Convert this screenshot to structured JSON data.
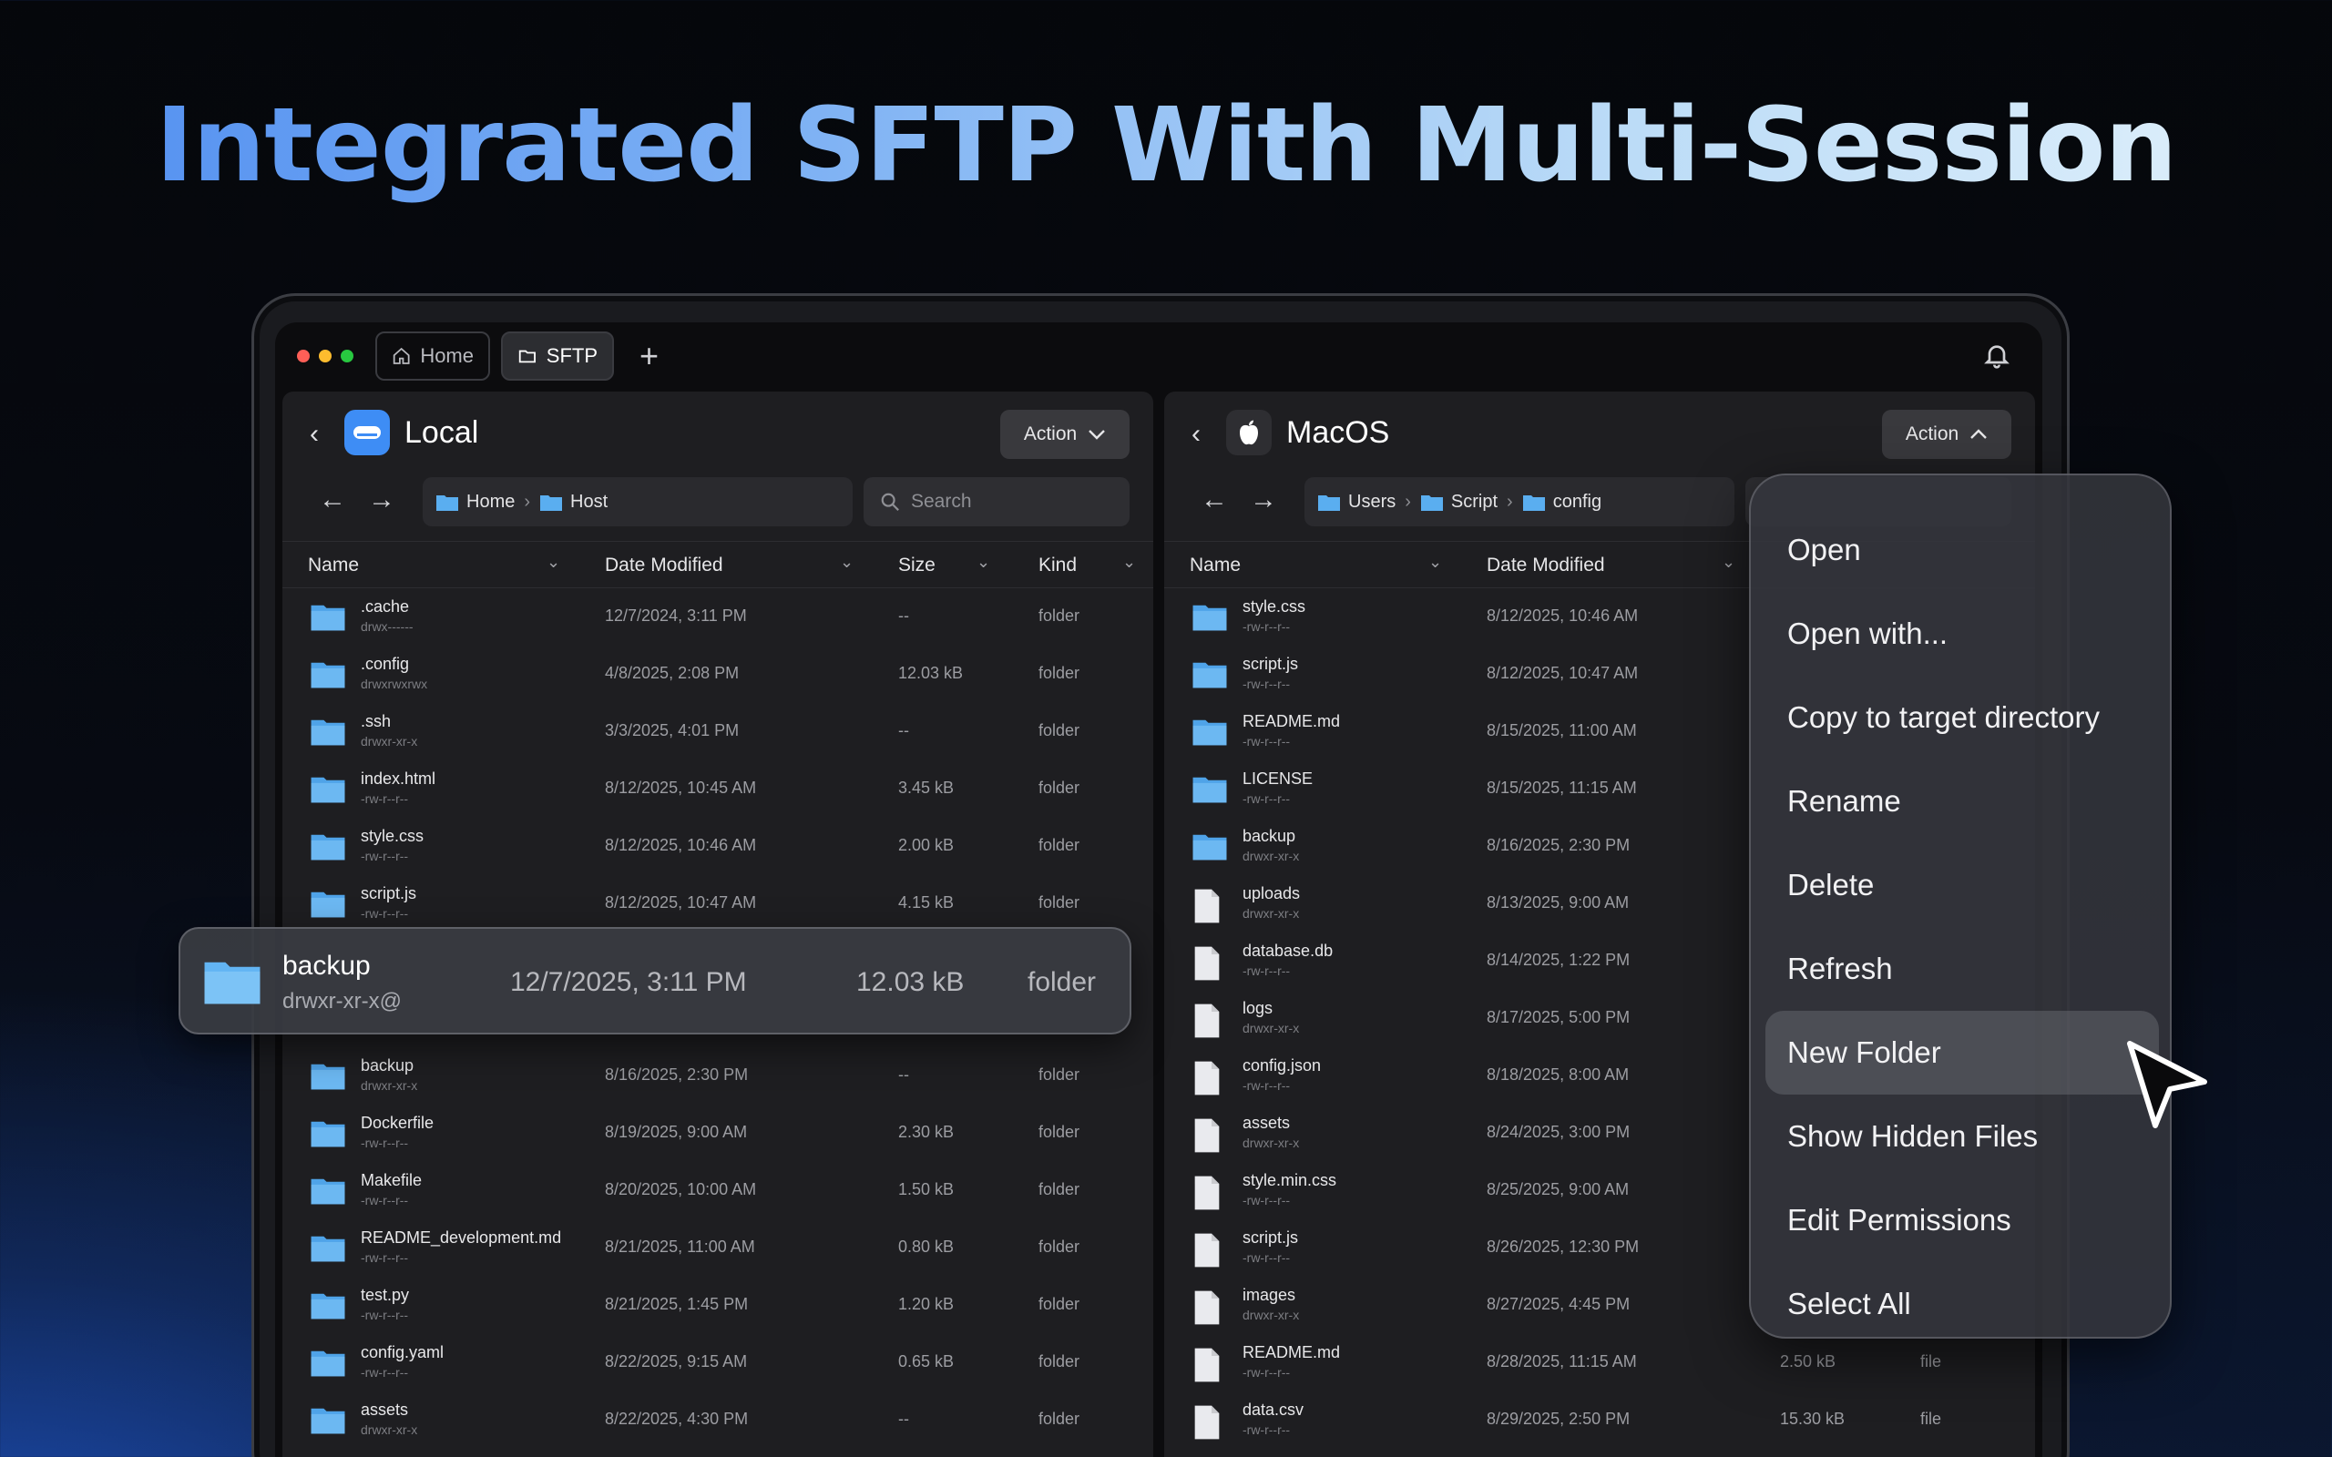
{
  "headline": "Integrated SFTP With Multi-Session",
  "titlebar": {
    "tabs": [
      {
        "label": "Home",
        "icon": "home-icon"
      },
      {
        "label": "SFTP",
        "icon": "folder-icon"
      }
    ],
    "new_tab_label": "+",
    "colors": {
      "close": "#ff5f57",
      "minimize": "#febc2e",
      "zoom": "#28c840"
    }
  },
  "left_pane": {
    "title": "Local",
    "action_label": "Action",
    "breadcrumb": [
      "Home",
      "Host"
    ],
    "search_placeholder": "Search",
    "columns": [
      "Name",
      "Date Modified",
      "Size",
      "Kind"
    ],
    "rows": [
      {
        "name": ".cache",
        "perm": "drwx------",
        "date": "12/7/2024, 3:11 PM",
        "size": "--",
        "kind": "folder"
      },
      {
        "name": ".config",
        "perm": "drwxrwxrwx",
        "date": "4/8/2025, 2:08 PM",
        "size": "12.03 kB",
        "kind": "folder"
      },
      {
        "name": ".ssh",
        "perm": "drwxr-xr-x",
        "date": "3/3/2025, 4:01 PM",
        "size": "--",
        "kind": "folder"
      },
      {
        "name": "index.html",
        "perm": "-rw-r--r--",
        "date": "8/12/2025, 10:45 AM",
        "size": "3.45 kB",
        "kind": "folder"
      },
      {
        "name": "style.css",
        "perm": "-rw-r--r--",
        "date": "8/12/2025, 10:46 AM",
        "size": "2.00 kB",
        "kind": "folder"
      },
      {
        "name": "script.js",
        "perm": "-rw-r--r--",
        "date": "8/12/2025, 10:47 AM",
        "size": "4.15 kB",
        "kind": "folder"
      },
      {
        "name": "",
        "perm": "",
        "date": "",
        "size": "",
        "kind": ""
      },
      {
        "name": "backup",
        "perm": "drwxr-xr-x",
        "date": "8/16/2025, 2:30 PM",
        "size": "--",
        "kind": "folder"
      },
      {
        "name": "Dockerfile",
        "perm": "-rw-r--r--",
        "date": "8/19/2025, 9:00 AM",
        "size": "2.30 kB",
        "kind": "folder"
      },
      {
        "name": "Makefile",
        "perm": "-rw-r--r--",
        "date": "8/20/2025, 10:00 AM",
        "size": "1.50 kB",
        "kind": "folder"
      },
      {
        "name": "README_development.md",
        "perm": "-rw-r--r--",
        "date": "8/21/2025, 11:00 AM",
        "size": "0.80 kB",
        "kind": "folder"
      },
      {
        "name": "test.py",
        "perm": "-rw-r--r--",
        "date": "8/21/2025, 1:45 PM",
        "size": "1.20 kB",
        "kind": "folder"
      },
      {
        "name": "config.yaml",
        "perm": "-rw-r--r--",
        "date": "8/22/2025, 9:15 AM",
        "size": "0.65 kB",
        "kind": "folder"
      },
      {
        "name": "assets",
        "perm": "drwxr-xr-x",
        "date": "8/22/2025, 4:30 PM",
        "size": "--",
        "kind": "folder"
      }
    ]
  },
  "drag_item": {
    "name": "backup",
    "perm": "drwxr-xr-x@",
    "date": "12/7/2025, 3:11 PM",
    "size": "12.03 kB",
    "kind": "folder"
  },
  "right_pane": {
    "title": "MacOS",
    "action_label": "Action",
    "breadcrumb": [
      "Users",
      "Script",
      "config"
    ],
    "columns": [
      "Name",
      "Date Modified"
    ],
    "rows": [
      {
        "name": "style.css",
        "perm": "-rw-r--r--",
        "date": "8/12/2025, 10:46 AM",
        "size": "",
        "kind": "",
        "icon": "folder-icon"
      },
      {
        "name": "script.js",
        "perm": "-rw-r--r--",
        "date": "8/12/2025, 10:47 AM",
        "size": "",
        "kind": "",
        "icon": "folder-icon"
      },
      {
        "name": "README.md",
        "perm": "-rw-r--r--",
        "date": "8/15/2025, 11:00 AM",
        "size": "",
        "kind": "",
        "icon": "folder-icon"
      },
      {
        "name": "LICENSE",
        "perm": "-rw-r--r--",
        "date": "8/15/2025, 11:15 AM",
        "size": "",
        "kind": "",
        "icon": "folder-icon"
      },
      {
        "name": "backup",
        "perm": "drwxr-xr-x",
        "date": "8/16/2025, 2:30 PM",
        "size": "",
        "kind": "",
        "icon": "folder-icon"
      },
      {
        "name": "uploads",
        "perm": "drwxr-xr-x",
        "date": "8/13/2025, 9:00 AM",
        "size": "",
        "kind": "",
        "icon": "file-icon"
      },
      {
        "name": "database.db",
        "perm": "-rw-r--r--",
        "date": "8/14/2025, 1:22 PM",
        "size": "",
        "kind": "",
        "icon": "file-icon"
      },
      {
        "name": "logs",
        "perm": "drwxr-xr-x",
        "date": "8/17/2025, 5:00 PM",
        "size": "",
        "kind": "",
        "icon": "file-icon"
      },
      {
        "name": "config.json",
        "perm": "-rw-r--r--",
        "date": "8/18/2025, 8:00 AM",
        "size": "",
        "kind": "",
        "icon": "file-icon"
      },
      {
        "name": "assets",
        "perm": "drwxr-xr-x",
        "date": "8/24/2025, 3:00 PM",
        "size": "",
        "kind": "",
        "icon": "file-icon"
      },
      {
        "name": "style.min.css",
        "perm": "-rw-r--r--",
        "date": "8/25/2025, 9:00 AM",
        "size": "",
        "kind": "",
        "icon": "file-icon"
      },
      {
        "name": "script.js",
        "perm": "-rw-r--r--",
        "date": "8/26/2025, 12:30 PM",
        "size": "",
        "kind": "",
        "icon": "file-icon"
      },
      {
        "name": "images",
        "perm": "drwxr-xr-x",
        "date": "8/27/2025, 4:45 PM",
        "size": "",
        "kind": "",
        "icon": "file-icon"
      },
      {
        "name": "README.md",
        "perm": "-rw-r--r--",
        "date": "8/28/2025, 11:15 AM",
        "size": "2.50 kB",
        "kind": "file",
        "icon": "file-icon"
      },
      {
        "name": "data.csv",
        "perm": "-rw-r--r--",
        "date": "8/29/2025, 2:50 PM",
        "size": "15.30 kB",
        "kind": "file",
        "icon": "file-icon"
      }
    ]
  },
  "context_menu": {
    "items": [
      "Open",
      "Open with...",
      "Copy to target directory",
      "Rename",
      "Delete",
      "Refresh",
      "New Folder",
      "Show Hidden Files",
      "Edit Permissions",
      "Select All"
    ],
    "highlighted": "New Folder"
  }
}
